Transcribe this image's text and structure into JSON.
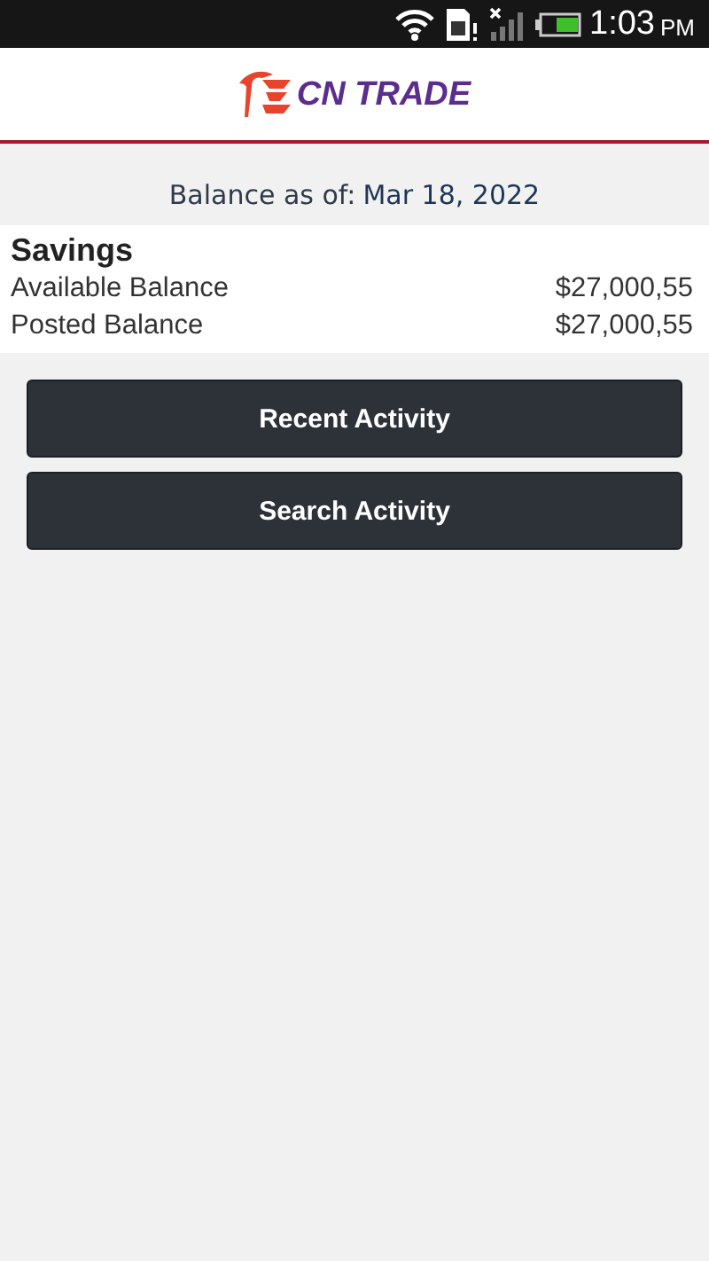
{
  "status_bar": {
    "time": "1:03",
    "period": "PM"
  },
  "header": {
    "logo_text": "CN TRADE"
  },
  "balance_date": {
    "label": "Balance as of:",
    "date": "Mar 18, 2022"
  },
  "account": {
    "name": "Savings",
    "rows": [
      {
        "label": "Available Balance",
        "amount": "$27,000,55"
      },
      {
        "label": "Posted Balance",
        "amount": "$27,000,55"
      }
    ]
  },
  "buttons": [
    "Recent Activity",
    "Search Activity"
  ]
}
